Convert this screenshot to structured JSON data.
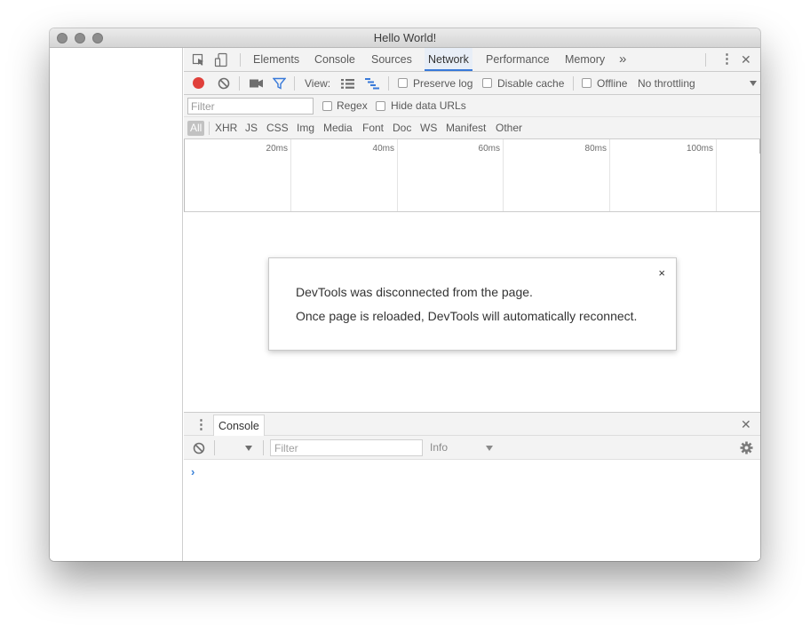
{
  "window": {
    "title": "Hello World!"
  },
  "devtools": {
    "tabs": [
      {
        "label": "Elements",
        "active": false
      },
      {
        "label": "Console",
        "active": false
      },
      {
        "label": "Sources",
        "active": false
      },
      {
        "label": "Network",
        "active": true
      },
      {
        "label": "Performance",
        "active": false
      },
      {
        "label": "Memory",
        "active": false
      }
    ],
    "more_tabs": "»",
    "close": "✕",
    "menu": "⋮"
  },
  "network_toolbar": {
    "view_label": "View:",
    "preserve_log": "Preserve log",
    "disable_cache": "Disable cache",
    "offline": "Offline",
    "throttling": "No throttling",
    "record_color": "#e0403b"
  },
  "filter_bar": {
    "filter_placeholder": "Filter",
    "regex": "Regex",
    "hide_data_urls": "Hide data URLs"
  },
  "type_filters": [
    "All",
    "XHR",
    "JS",
    "CSS",
    "Img",
    "Media",
    "Font",
    "Doc",
    "WS",
    "Manifest",
    "Other"
  ],
  "timeline": {
    "ticks": [
      "20ms",
      "40ms",
      "60ms",
      "80ms",
      "100ms"
    ]
  },
  "dialog": {
    "close": "×",
    "line1": "DevTools was disconnected from the page.",
    "line2": "Once page is reloaded, DevTools will automatically reconnect."
  },
  "drawer": {
    "tab_label": "Console",
    "close": "✕",
    "menu": "⋮",
    "filter_placeholder": "Filter",
    "level": "Info",
    "prompt": "›"
  },
  "colors": {
    "accent": "#3879d9",
    "toolbar_bg": "#f3f3f3",
    "prompt": "#3b82d8"
  }
}
